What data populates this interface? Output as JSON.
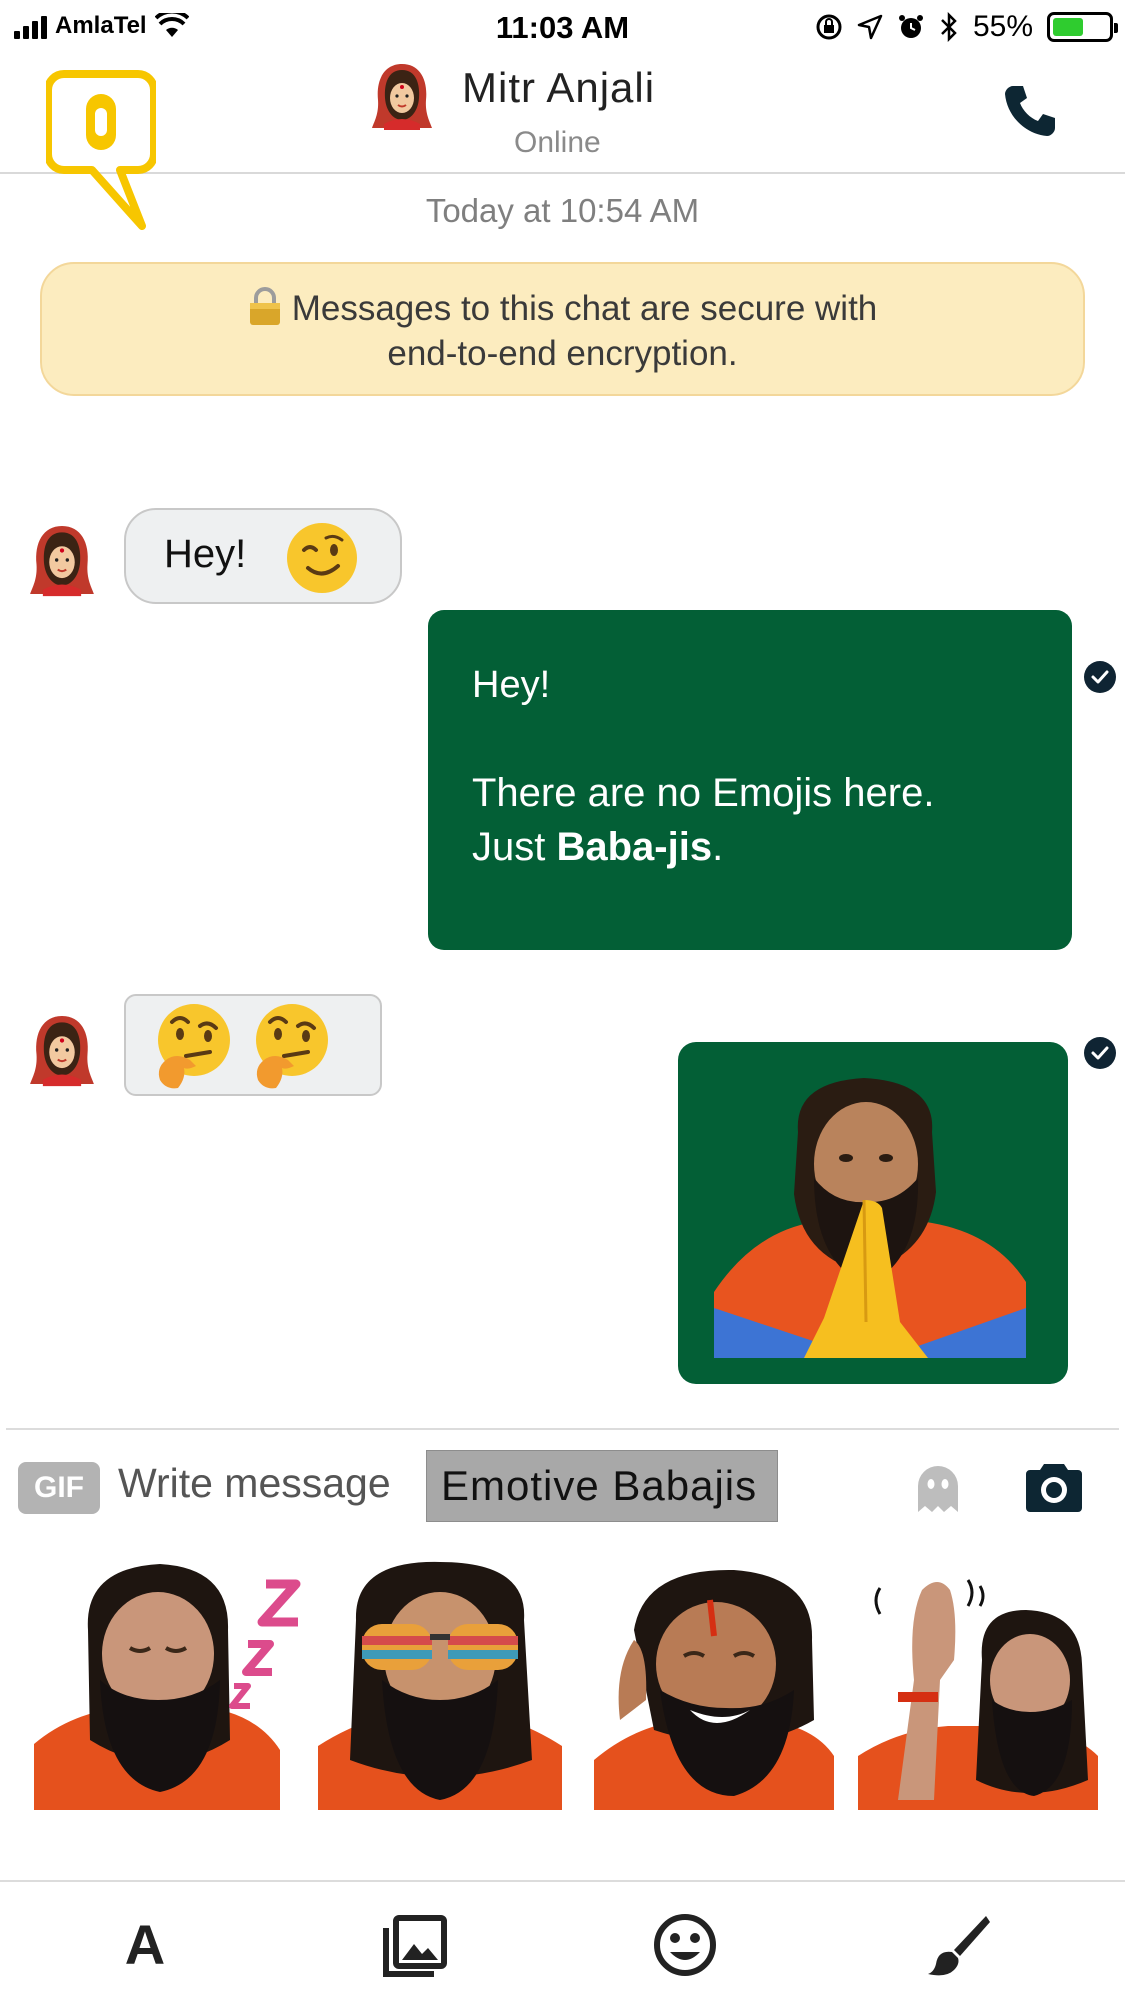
{
  "status_bar": {
    "carrier": "AmlaTel",
    "time": "11:03 AM",
    "battery": "55%",
    "battery_level": 0.55
  },
  "header": {
    "contact_name": "Mitr Anjali",
    "contact_status": "Online"
  },
  "chat": {
    "date_separator": "Today at 10:54 AM",
    "encryption_notice_line1": "Messages to this chat are secure with",
    "encryption_notice_line2": "end-to-end encryption.",
    "messages": [
      {
        "from": "contact",
        "text": "Hey!",
        "emoji": "winking-face"
      },
      {
        "from": "me",
        "line1": "Hey!",
        "line2": "There are no Emojis here.",
        "line3_prefix": "Just ",
        "line3_bold": "Baba-jis",
        "line3_suffix": "."
      },
      {
        "from": "contact",
        "emoji": "thinking-face x2"
      },
      {
        "from": "me",
        "sticker": "baba-namaste-sticker"
      }
    ]
  },
  "composer": {
    "gif_label": "GIF",
    "placeholder": "Write message",
    "suggestion": "Emotive Babajis"
  },
  "sticker_tray": {
    "items": [
      "sleeping-baba-sticker",
      "sunglasses-baba-sticker",
      "laughing-baba-sticker",
      "waving-baba-sticker"
    ]
  },
  "toolbar": {
    "font_label": "A",
    "icons": [
      "font-icon",
      "gallery-icon",
      "emoji-icon",
      "brush-icon"
    ]
  },
  "colors": {
    "outgoing_bubble": "#035f36",
    "encryption_banner": "#fcecbf",
    "logo_yellow": "#f7c600"
  }
}
